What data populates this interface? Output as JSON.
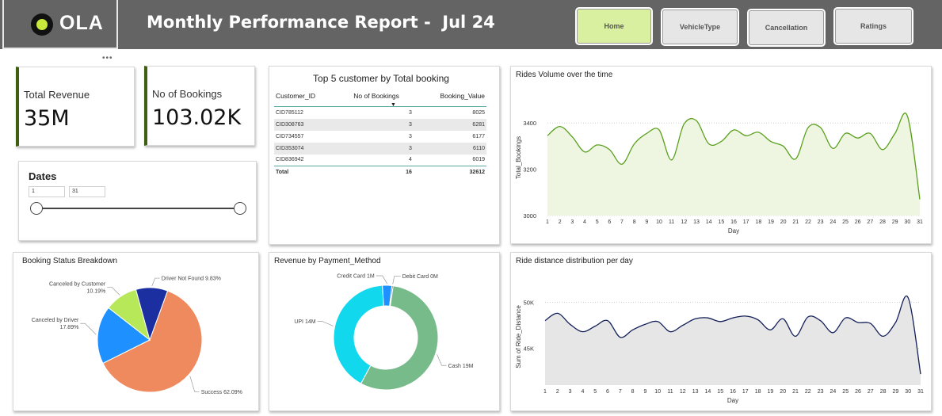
{
  "header": {
    "logo_text": "OLA",
    "title": "Monthly Performance Report -  Jul 24",
    "nav": [
      {
        "label": "Home",
        "active": true
      },
      {
        "label": "VehicleType",
        "active": false
      },
      {
        "label": "Cancellation",
        "active": false
      },
      {
        "label": "Ratings",
        "active": false
      }
    ],
    "more_glyph": "•••"
  },
  "kpis": {
    "revenue": {
      "label": "Total Revenue",
      "value": "35M"
    },
    "bookings": {
      "label": "No of Bookings",
      "value": "103.02K"
    }
  },
  "dates_slicer": {
    "title": "Dates",
    "from": "1",
    "to": "31",
    "start": 1,
    "end": 31,
    "min": 1,
    "max": 31
  },
  "top5": {
    "title": "Top 5 customer by Total booking",
    "columns": [
      "Customer_ID",
      "No of Bookings",
      "Booking_Value"
    ],
    "sort_glyph": "▼",
    "rows": [
      [
        "CID785112",
        "3",
        "8025"
      ],
      [
        "CID308763",
        "3",
        "6281"
      ],
      [
        "CID734557",
        "3",
        "6177"
      ],
      [
        "CID353074",
        "3",
        "6110"
      ],
      [
        "CID836942",
        "4",
        "6019"
      ]
    ],
    "total": [
      "Total",
      "16",
      "32612"
    ]
  },
  "colors": {
    "accent_green": "#d9f0a0",
    "line_green": "#5aa01e",
    "area_green": "#eef5e0",
    "navy": "#14205a",
    "kpi_bar": "#3e5f12"
  },
  "chart_data": [
    {
      "type": "area",
      "title": "Rides Volume over the time",
      "xlabel": "Day",
      "ylabel": "Total_Bookings",
      "ylim": [
        3000,
        3500
      ],
      "yticks": [
        3000,
        3200,
        3400
      ],
      "grid": true,
      "x": [
        1,
        2,
        3,
        4,
        5,
        6,
        7,
        8,
        9,
        10,
        11,
        12,
        13,
        14,
        15,
        16,
        17,
        18,
        19,
        20,
        21,
        22,
        23,
        24,
        25,
        26,
        27,
        28,
        29,
        30,
        31
      ],
      "values": [
        3345,
        3385,
        3340,
        3275,
        3305,
        3285,
        3222,
        3310,
        3355,
        3370,
        3240,
        3395,
        3410,
        3310,
        3320,
        3370,
        3345,
        3360,
        3320,
        3300,
        3245,
        3380,
        3380,
        3290,
        3355,
        3335,
        3355,
        3285,
        3355,
        3430,
        3070
      ]
    },
    {
      "type": "pie",
      "title": "Booking Status Breakdown",
      "slices": [
        {
          "label": "Success",
          "display": "Success 62.09%",
          "value": 62.09,
          "color": "#ef8a5e"
        },
        {
          "label": "Canceled by Driver",
          "display": "Canceled by Driver\n17.89%",
          "value": 17.89,
          "color": "#1e90ff"
        },
        {
          "label": "Canceled by Customer",
          "display": "Canceled by Customer\n10.19%",
          "value": 10.19,
          "color": "#b6e85a"
        },
        {
          "label": "Driver Not Found",
          "display": "Driver Not Found 9.83%",
          "value": 9.83,
          "color": "#1c2fa0"
        }
      ]
    },
    {
      "type": "pie",
      "subtype": "donut",
      "title": "Revenue by Payment_Method",
      "slices": [
        {
          "label": "Cash",
          "display": "Cash 19M",
          "value": 19,
          "color": "#78bb8b"
        },
        {
          "label": "UPI",
          "display": "UPI 14M",
          "value": 14,
          "color": "#12d8ee"
        },
        {
          "label": "Credit Card",
          "display": "Credit Card 1M",
          "value": 1,
          "color": "#1e90ff"
        },
        {
          "label": "Debit Card",
          "display": "Debit Card 0M",
          "value": 0.12,
          "color": "#1c2fa0"
        }
      ]
    },
    {
      "type": "area",
      "title": "Ride distance distribution per day",
      "xlabel": "Day",
      "ylabel": "Sum of Ride_Distance",
      "ylim": [
        41000,
        51500
      ],
      "yticks": [
        45000,
        50000
      ],
      "ytick_labels": [
        "45K",
        "50K"
      ],
      "grid": true,
      "x": [
        1,
        2,
        3,
        4,
        5,
        6,
        7,
        8,
        9,
        10,
        11,
        12,
        13,
        14,
        15,
        16,
        17,
        18,
        19,
        20,
        21,
        22,
        23,
        24,
        25,
        26,
        27,
        28,
        29,
        30,
        31
      ],
      "values": [
        48000,
        48800,
        47600,
        46800,
        47400,
        48000,
        46200,
        47000,
        47600,
        47900,
        46800,
        47500,
        48200,
        48300,
        47900,
        48300,
        48500,
        48100,
        47000,
        48200,
        46300,
        48400,
        48000,
        46700,
        48300,
        47800,
        47700,
        46300,
        47800,
        50500,
        42200
      ]
    }
  ]
}
